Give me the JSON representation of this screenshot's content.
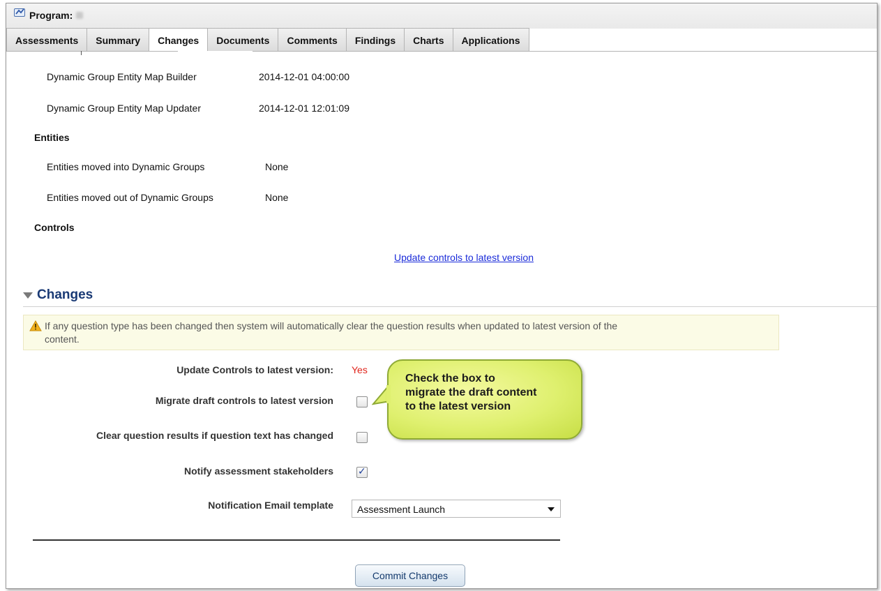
{
  "program": {
    "label": "Program:"
  },
  "tabs": [
    {
      "label": "Assessments",
      "active": false
    },
    {
      "label": "Summary",
      "active": false
    },
    {
      "label": "Changes",
      "active": true
    },
    {
      "label": "Documents",
      "active": false
    },
    {
      "label": "Comments",
      "active": false
    },
    {
      "label": "Findings",
      "active": false
    },
    {
      "label": "Charts",
      "active": false
    },
    {
      "label": "Applications",
      "active": false
    }
  ],
  "jobs": [
    {
      "name": "Dynamic Group Entity Map Builder",
      "time": "2014-12-01 04:00:00"
    },
    {
      "name": "Dynamic Group Entity Map Updater",
      "time": "2014-12-01 12:01:09"
    }
  ],
  "entities": {
    "heading": "Entities",
    "rows": [
      {
        "label": "Entities moved into Dynamic Groups",
        "value": "None"
      },
      {
        "label": "Entities moved out of Dynamic Groups",
        "value": "None"
      }
    ]
  },
  "controls": {
    "heading": "Controls",
    "update_link": "Update controls to latest version"
  },
  "changes": {
    "heading": "Changes",
    "warning_line1": "If any question type has been changed then system will automatically clear the question results when updated to latest version of the",
    "warning_line2": "content.",
    "update_label": "Update Controls to latest version:",
    "update_value": "Yes",
    "migrate_label": "Migrate draft controls to latest version",
    "migrate_checked": false,
    "clear_label": "Clear question results if question text has changed",
    "clear_checked": false,
    "notify_label": "Notify assessment stakeholders",
    "notify_checked": true,
    "template_label": "Notification Email template",
    "template_value": "Assessment Launch",
    "commit_label": "Commit Changes"
  },
  "callout": {
    "line1": "Check the box to",
    "line2": "migrate the draft content",
    "line3": "to the latest version"
  },
  "colors": {
    "link": "#1a2bd9",
    "section_heading": "#1a3a75",
    "yes_value": "#e0241b",
    "callout_fill": "#dff06f",
    "callout_border": "#8faa35",
    "warning_bg": "#fbfbe6"
  },
  "icons": {
    "program": "program-icon",
    "warning": "warning-icon",
    "collapse": "triangle-down-icon",
    "dropdown": "chevron-down-icon",
    "check": "checkmark-icon"
  }
}
